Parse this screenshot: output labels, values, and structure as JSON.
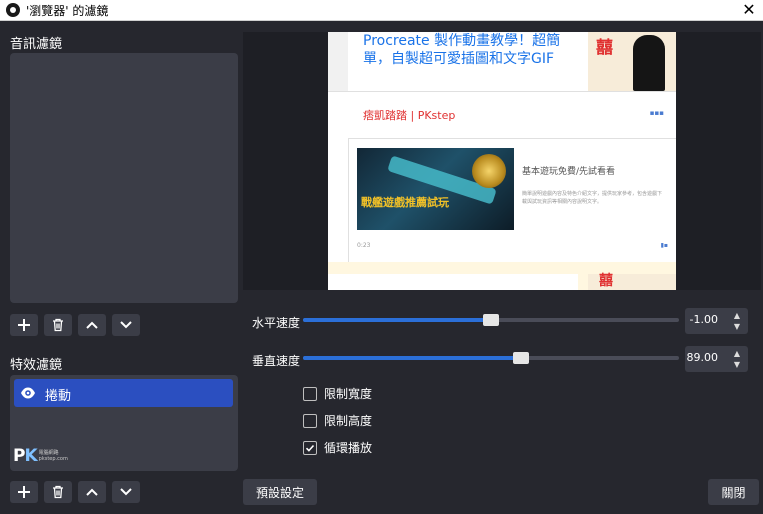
{
  "window": {
    "title": "'瀏覽器' 的濾鏡",
    "close_glyph": "✕"
  },
  "audio_filters": {
    "label": "音訊濾鏡"
  },
  "effect_filters": {
    "label": "特效濾鏡",
    "items": [
      {
        "label": "捲動",
        "icon": "eye-icon"
      }
    ]
  },
  "watermark": {
    "logo_p": "P",
    "logo_k": "K",
    "subtitle_line1": "電腦網路",
    "subtitle_line2": "pkstep.com"
  },
  "preview": {
    "headline": "Procreate 製作動畫教學！超簡單，自製超可愛插圖和文字GIF",
    "author": "痞凱踏踏 | PKstep",
    "menu_glyph": "▪▪▪",
    "inner_title": "基本遊玩免費/先試看看",
    "inner_text": "簡單說明遊戲內容及特色介紹文字，提供玩家參考，包含遊戲下載與試玩資訊等相關內容說明文字。",
    "thumb_caption": "戰艦遊戲推薦試玩",
    "inner_foot": "0:23",
    "inner_foot_right": "▮▪",
    "red_glyph": "囍"
  },
  "controls": {
    "horizontal_speed": {
      "label": "水平速度",
      "value": "-1.00",
      "position": 0.5
    },
    "vertical_speed": {
      "label": "垂直速度",
      "value": "89.00",
      "position": 0.58
    },
    "spin_up": "▲",
    "spin_down": "▼",
    "checkboxes": [
      {
        "label": "限制寬度",
        "checked": false
      },
      {
        "label": "限制高度",
        "checked": false
      },
      {
        "label": "循環播放",
        "checked": true
      }
    ]
  },
  "buttons": {
    "defaults": "預設設定",
    "close": "關閉"
  },
  "colors": {
    "accent": "#2b6fd8",
    "selected": "#2b4fc0",
    "panel": "#3b3d47",
    "background": "#26272e"
  }
}
